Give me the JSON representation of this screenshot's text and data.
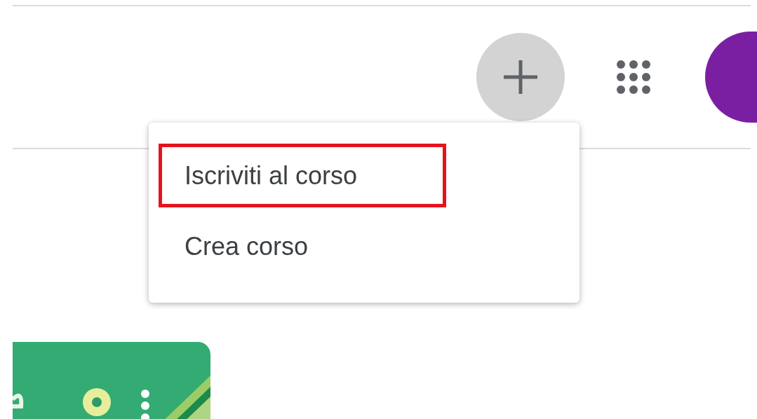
{
  "menu": {
    "items": [
      {
        "label": "Iscriviti al corso",
        "highlighted": true
      },
      {
        "label": "Crea corso",
        "highlighted": false
      }
    ]
  }
}
